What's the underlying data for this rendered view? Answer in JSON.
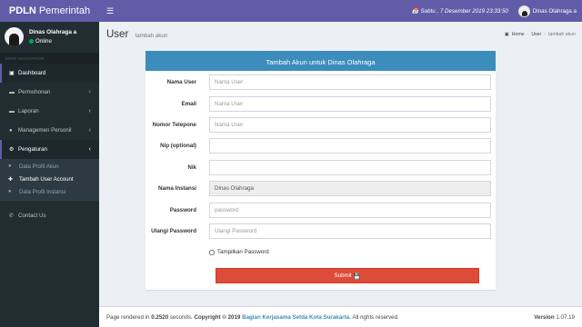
{
  "app": {
    "logo_bold": "PDLN",
    "logo_rest": "Pemerintah",
    "datetime": "Sabtu , 7 Desember 2019 23:33:50",
    "user_top": "Dinas Olahraga a"
  },
  "sidebar": {
    "user_name": "Dinas Olahraga a",
    "status": "Online",
    "nav_header": "MAIN NAVIGATION",
    "items": [
      {
        "label": "Dashboard"
      },
      {
        "label": "Permohonan"
      },
      {
        "label": "Laporan"
      },
      {
        "label": "Managemen Personil"
      },
      {
        "label": "Pengaturan"
      }
    ],
    "sub_items": [
      {
        "label": "Data Profil Akun"
      },
      {
        "label": "Tambah User Account"
      },
      {
        "label": "Data Profil Instansi"
      }
    ],
    "contact": "Contact Us"
  },
  "content": {
    "title": "User",
    "subtitle": "tambah akun",
    "breadcrumb": [
      "Home",
      "User",
      "tambah akun"
    ]
  },
  "form": {
    "header": "Tambah Akun untuk Dinas Olahraga",
    "fields": [
      {
        "label": "Nama User",
        "placeholder": "Nama User",
        "value": ""
      },
      {
        "label": "Email",
        "placeholder": "Nama User",
        "value": ""
      },
      {
        "label": "Nomor Telepone",
        "placeholder": "Nama User",
        "value": ""
      },
      {
        "label": "Nip (optional)",
        "placeholder": "",
        "value": ""
      },
      {
        "label": "Nik",
        "placeholder": "",
        "value": ""
      },
      {
        "label": "Nama Instansi",
        "placeholder": "",
        "value": "Dinas Olahraga"
      },
      {
        "label": "Password",
        "placeholder": "password",
        "value": ""
      },
      {
        "label": "Ulangi Password",
        "placeholder": "Ulangi Password",
        "value": ""
      }
    ],
    "show_password": "Tampilkan Password",
    "submit": "Submit"
  },
  "footer": {
    "prefix": "Page rendered in",
    "time": "0.2520",
    "seconds": "seconds.",
    "copyright": "Copyright © 2019",
    "org": "Bagian Kerjasama Setda Kota Surakarta.",
    "rights": "All rights reserved.",
    "version_label": "Version",
    "version": "1.07.19"
  }
}
